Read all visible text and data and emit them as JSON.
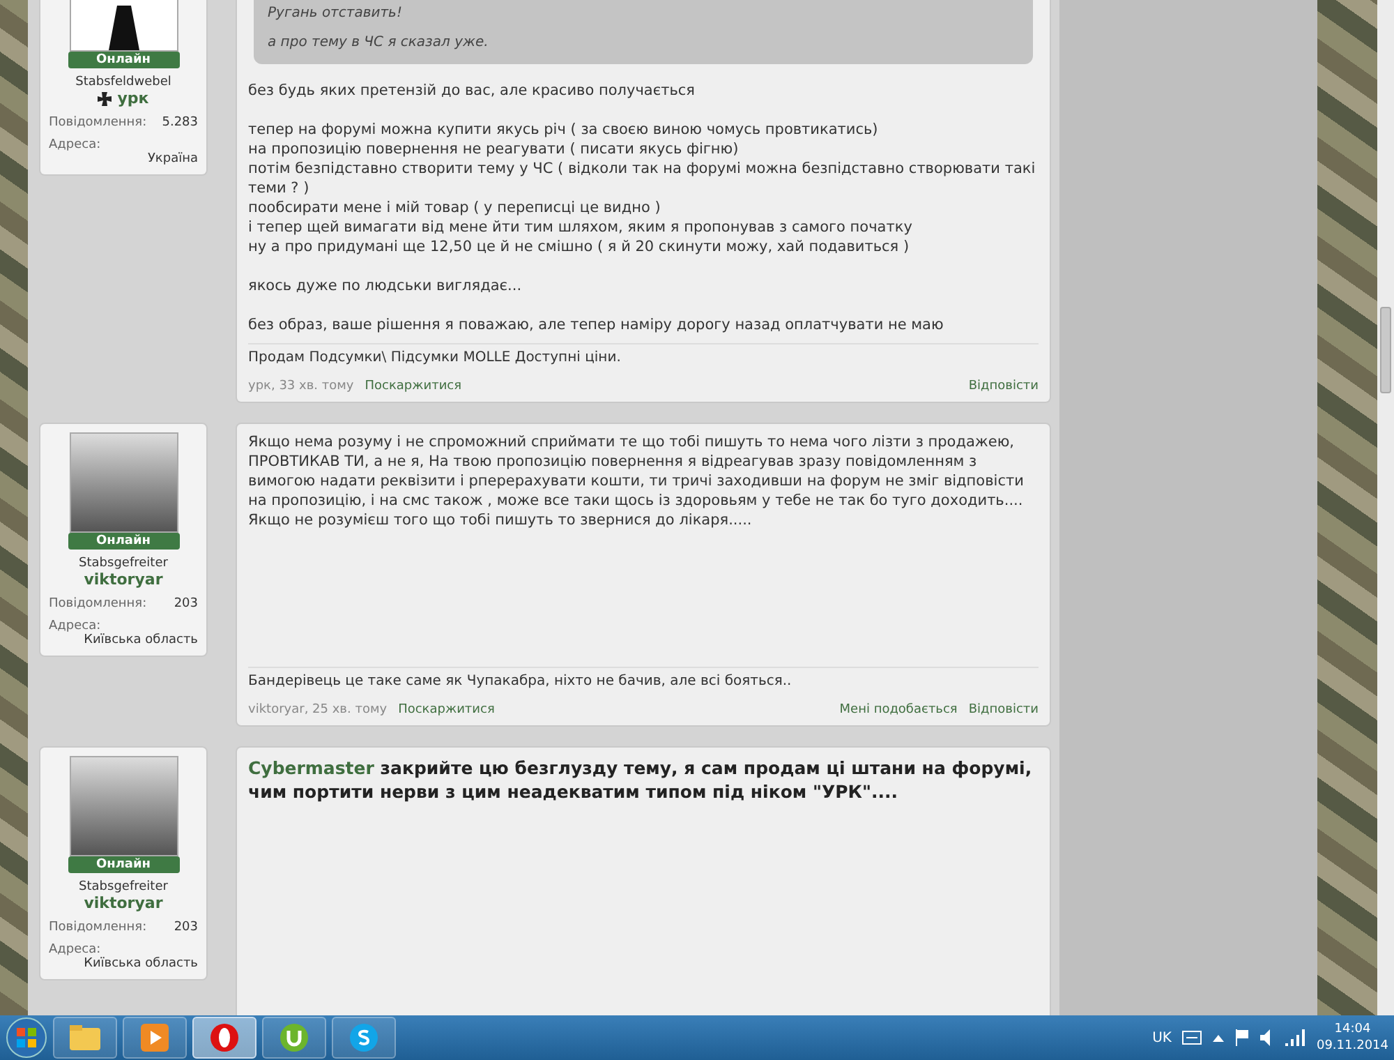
{
  "posts": [
    {
      "user": {
        "avatar": {
          "kind": "emblem"
        },
        "online": "Онлайн",
        "rank": "Stabsfeldwebel",
        "name": "урк",
        "cross": true,
        "stats": [
          {
            "label": "Повідомлення:",
            "value": "5.283"
          }
        ],
        "address_label": "Адреса:",
        "address": "Україна"
      },
      "quote": [
        "Ругань отставить!",
        "а про тему в ЧС я сказал уже."
      ],
      "body": [
        [
          "без будь яких претензій до вас, але красиво получається"
        ],
        [
          "тепер на форумі можна купити якусь річ ( за своєю виною чомусь провтикатись)",
          "на пропозицію повернення не реагувати ( писати якусь фігню)",
          "потім безпідставно створити тему у ЧС ( відколи так на форумі можна безпідставно створювати такі теми ? )",
          "пообсирати мене і мій товар ( у переписці це видно )",
          "і тепер щей вимагати від мене йти тим шляхом, яким я пропонував з самого початку",
          "ну а про придумані ще 12,50 це й не смішно ( я й 20 скинути можу, хай подавиться )"
        ],
        [
          "якось дуже по людськи виглядає..."
        ],
        [
          "без образ, ваше рішення я поважаю, але тепер наміру дорогу назад оплатчувати не маю"
        ]
      ],
      "signature": "Продам Подсумки\\ Підсумки MOLLE Доступні ціни.",
      "meta": {
        "author_time": "урк, 33 хв. тому",
        "report": "Поскаржитися",
        "actions": [
          "Відповісти"
        ]
      }
    },
    {
      "user": {
        "avatar": {
          "kind": "photo"
        },
        "online": "Онлайн",
        "rank": "Stabsgefreiter",
        "name": "viktoryar",
        "cross": false,
        "stats": [
          {
            "label": "Повідомлення:",
            "value": "203"
          }
        ],
        "address_label": "Адреса:",
        "address": "Київська область"
      },
      "body": [
        [
          "Якщо нема розуму і не спроможний сприймати те що тобі пишуть то нема чого лізти з продажею, ПРОВТИКАВ ТИ, а не я, На твою пропозицію повернення я відреагував зразу повідомленням з вимогою надати реквізити і рперерахувати кошти, ти тричі заходивши на форум не зміг відповісти на пропозицію, і на смс також , може все таки щось із здоровьям у тебе не так бо туго доходить.... Якщо не розумієш того що тобі пишуть то звернися до лікаря....."
        ]
      ],
      "signature": "Бандерівець це таке саме як Чупакабра, ніхто не бачив, але всі бояться..",
      "meta": {
        "author_time": "viktoryar, 25 хв. тому",
        "report": "Поскаржитися",
        "actions": [
          "Мені подобається",
          "Відповісти"
        ]
      }
    },
    {
      "user": {
        "avatar": {
          "kind": "photo"
        },
        "online": "Онлайн",
        "rank": "Stabsgefreiter",
        "name": "viktoryar",
        "cross": false,
        "stats": [
          {
            "label": "Повідомлення:",
            "value": "203"
          }
        ],
        "address_label": "Адреса:",
        "address": "Київська область"
      },
      "mention": "Cybermaster",
      "bold_body": "закрийте цю безглузду тему, я сам продам ці штани на форумі, чим портити нерви з цим неадекватим типом під ніком \"УРК\"...."
    }
  ],
  "taskbar": {
    "apps": [
      {
        "kind": "explorer",
        "selected": false
      },
      {
        "kind": "media",
        "selected": false
      },
      {
        "kind": "opera",
        "selected": true
      },
      {
        "kind": "torrent",
        "selected": false
      },
      {
        "kind": "skype",
        "selected": false
      }
    ],
    "language": "UK",
    "time": "14:04",
    "date": "09.11.2014"
  }
}
